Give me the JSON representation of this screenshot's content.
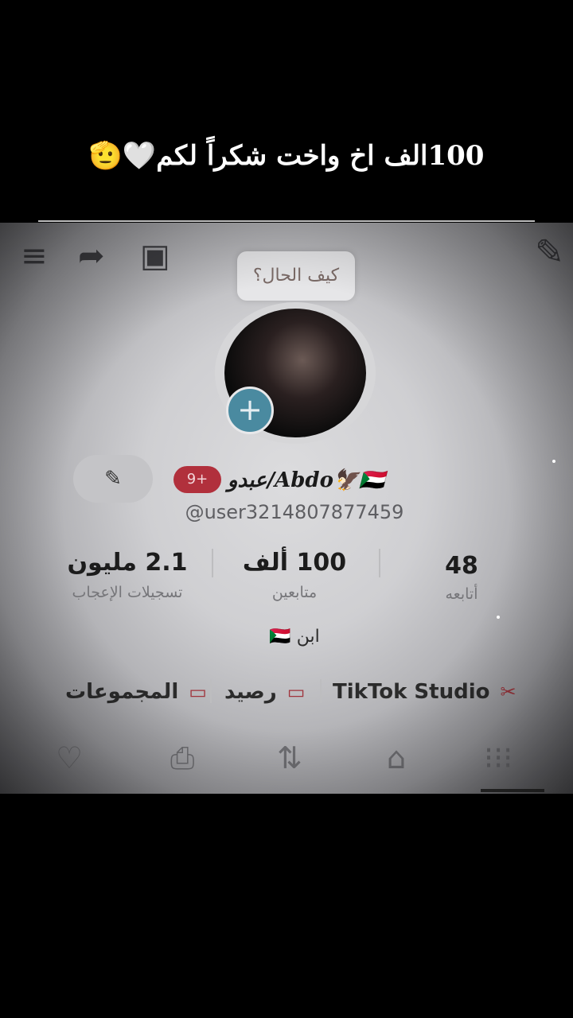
{
  "caption": "100الف اخ  واخت شكراً لكم🤍🫡",
  "profile": {
    "note": "كيف الحال؟",
    "badge": "9+",
    "name": "عبدو/Abdo🦅🇸🇩",
    "handle": "@user3214807877459",
    "bio": "ابن 🇸🇩",
    "stats": {
      "following_value": "48",
      "following_label": "أتابعه",
      "followers_value": "100 ألف",
      "followers_label": "متابعين",
      "likes_value": "2.1 مليون",
      "likes_label": "تسجيلات الإعجاب"
    },
    "links": {
      "studio": "TikTok Studio",
      "balance": "رصيد",
      "groups": "المجموعات"
    }
  },
  "icons": {
    "menu": "menu-icon",
    "share": "share-icon",
    "calendar": "calendar-star-icon",
    "edit": "pencil-icon",
    "plus": "plus-icon",
    "heart": "heart-icon",
    "bookmark": "bookmark-icon",
    "repost": "repost-icon",
    "lock": "lock-icon",
    "grid": "grid-icon"
  },
  "colors": {
    "badge": "#b1303c",
    "plus": "#4a8aa0"
  }
}
